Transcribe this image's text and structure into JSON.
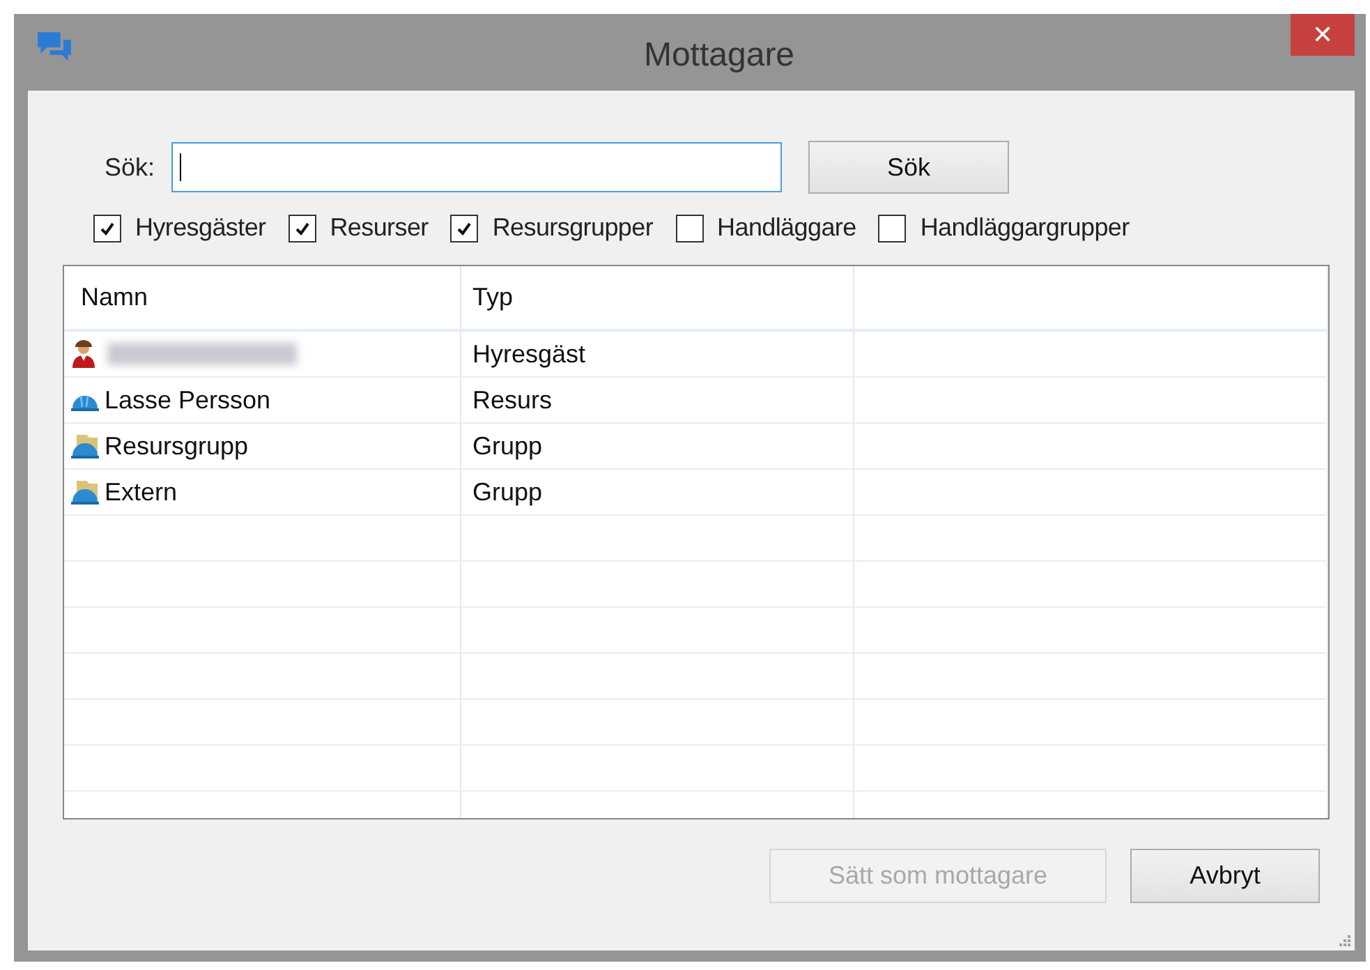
{
  "window": {
    "title": "Mottagare",
    "close": "✕"
  },
  "search": {
    "label": "Sök:",
    "button": "Sök"
  },
  "filters": [
    {
      "label": "Hyresgäster",
      "checked": true
    },
    {
      "label": "Resurser",
      "checked": true
    },
    {
      "label": "Resursgrupper",
      "checked": true
    },
    {
      "label": "Handläggare",
      "checked": false
    },
    {
      "label": "Handläggargrupper",
      "checked": false
    }
  ],
  "table": {
    "columns": [
      "Namn",
      "Typ"
    ],
    "rows": [
      {
        "kind": "person",
        "redacted": true,
        "type": "Hyresgäst"
      },
      {
        "kind": "resource",
        "redacted": false,
        "name": "Lasse Persson",
        "type": "Resurs"
      },
      {
        "kind": "group",
        "redacted": false,
        "name": "Resursgrupp",
        "type": "Grupp"
      },
      {
        "kind": "group",
        "redacted": false,
        "name": "Extern",
        "type": "Grupp"
      }
    ]
  },
  "buttons": [
    {
      "label": "Sätt som mottagare",
      "disabled": true
    },
    {
      "label": "Avbryt",
      "disabled": false
    }
  ]
}
